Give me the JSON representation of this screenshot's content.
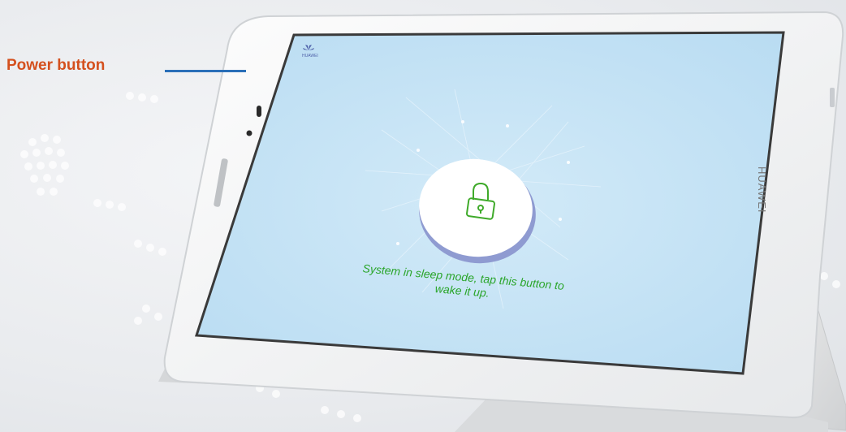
{
  "callout": {
    "label": "Power button"
  },
  "device": {
    "side_brand": "HUAWEI",
    "screen_brand": "HUAWEI",
    "screen_message": "System in sleep mode, tap this button to wake it up.",
    "lock_icon": "lock-icon"
  },
  "colors": {
    "callout_text": "#d4501e",
    "callout_line": "#2a6fb8",
    "screen_bg": "#c4e1f5",
    "message_text": "#2aa52a"
  }
}
